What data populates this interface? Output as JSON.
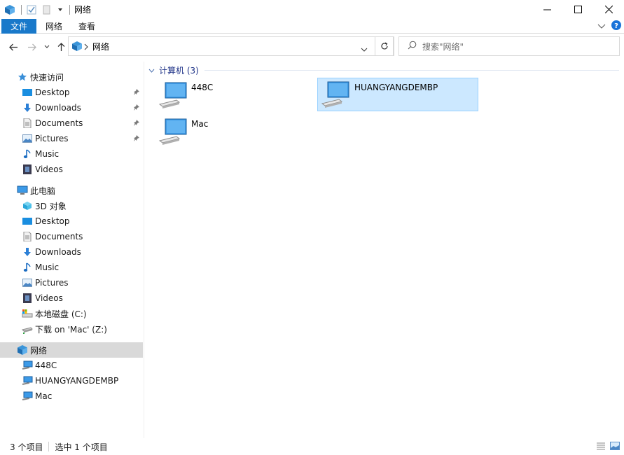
{
  "window": {
    "title": "网络"
  },
  "ribbon": {
    "tabs": [
      "文件",
      "网络",
      "查看"
    ]
  },
  "address": {
    "crumb": "网络",
    "search_placeholder": "搜索\"网络\""
  },
  "nav": {
    "quick_access": "快速访问",
    "quick_items": [
      "Desktop",
      "Downloads",
      "Documents",
      "Pictures",
      "Music",
      "Videos"
    ],
    "this_pc": "此电脑",
    "pc_items": [
      "3D 对象",
      "Desktop",
      "Documents",
      "Downloads",
      "Music",
      "Pictures",
      "Videos",
      "本地磁盘 (C:)",
      "下载 on 'Mac' (Z:)"
    ],
    "network": "网络",
    "network_items": [
      "448C",
      "HUANGYANGDEMBP",
      "Mac"
    ]
  },
  "content": {
    "group_label": "计算机 (3)",
    "computers": [
      "448C",
      "HUANGYANGDEMBP",
      "Mac"
    ]
  },
  "status": {
    "count": "3 个项目",
    "selected": "选中 1 个项目"
  },
  "colors": {
    "accent": "#1979ca",
    "selection": "#cce8ff",
    "group_text": "#1e3287"
  }
}
